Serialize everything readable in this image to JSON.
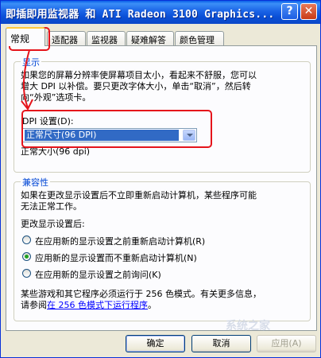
{
  "window": {
    "title": "即插即用监视器 和 ATI Radeon 3100 Graphics...",
    "help_glyph": "?",
    "close_glyph": "✕"
  },
  "tabs": [
    {
      "label": "常规",
      "active": true
    },
    {
      "label": "适配器",
      "active": false
    },
    {
      "label": "监视器",
      "active": false
    },
    {
      "label": "疑难解答",
      "active": false
    },
    {
      "label": "颜色管理",
      "active": false
    }
  ],
  "display_group": {
    "title": "显示",
    "description_lines": [
      "如果您的屏幕分辨率使屏幕项目太小，看起来不舒服，您可以",
      "增大 DPI 以补偿。要只更改字体大小，单击“取消”，然后转",
      "向“外观”选项卡。"
    ],
    "dpi_label": "DPI 设置(D):",
    "dpi_value": "正常尺寸(96 DPI)",
    "dpi_note": "正常大小(96 dpi)"
  },
  "compat_group": {
    "title": "兼容性",
    "description_lines": [
      "如果在更改显示设置后不立即重新启动计算机，某些程序可能",
      "无法正常工作。"
    ],
    "after_change_label": "更改显示设置后:",
    "options": [
      {
        "label": "在应用新的显示设置之前重新启动计算机(R)",
        "checked": false
      },
      {
        "label": "应用新的显示设置而不重新启动计算机(N)",
        "checked": true
      },
      {
        "label": "在应用新的显示设置之前询问(K)",
        "checked": false
      }
    ],
    "footer_line1": "某些游戏和其它程序必须运行于 256 色模式。有关更多信息，",
    "footer_prefix": "请参阅",
    "footer_link": "在 256 色模式下运行程序",
    "footer_suffix": "。"
  },
  "buttons": {
    "ok": "确定",
    "cancel": "取消",
    "apply": "应用(A)"
  },
  "watermark": "系统之家",
  "colors": {
    "title_bar": "#0a4fd6",
    "group_title": "#0046d5",
    "selection": "#316ac5",
    "annotation": "#e5141b"
  }
}
